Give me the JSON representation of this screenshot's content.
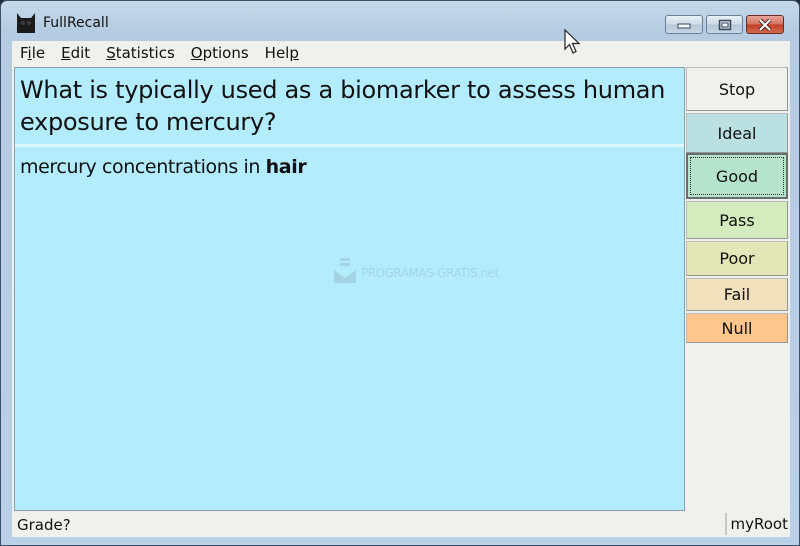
{
  "window": {
    "title": "FullRecall",
    "app_icon": "owl-icon",
    "controls": {
      "minimize": "minimize-icon",
      "maximize": "maximize-icon",
      "close": "close-icon"
    }
  },
  "menubar": {
    "items": [
      {
        "label": "File",
        "mnemonic": "i"
      },
      {
        "label": "Edit",
        "mnemonic": "E"
      },
      {
        "label": "Statistics",
        "mnemonic": "S"
      },
      {
        "label": "Options",
        "mnemonic": "O"
      },
      {
        "label": "Help",
        "mnemonic": "p"
      }
    ]
  },
  "card": {
    "question": "What is typically used as a biomarker to assess human exposure to mercury?",
    "answer_prefix": "mercury concentrations in ",
    "answer_bold": "hair"
  },
  "watermark": {
    "text": "PROGRAMAS-GRATIS.net"
  },
  "grades": [
    {
      "label": "Stop",
      "color": "#f0f0ed",
      "focused": false
    },
    {
      "label": "Ideal",
      "color": "#bae0e2",
      "focused": false
    },
    {
      "label": "Good",
      "color": "#b5e3cb",
      "focused": true
    },
    {
      "label": "Pass",
      "color": "#d3ebbd",
      "focused": false
    },
    {
      "label": "Poor",
      "color": "#e3e6b6",
      "focused": false
    },
    {
      "label": "Fail",
      "color": "#f2dfbb",
      "focused": false
    },
    {
      "label": "Null",
      "color": "#fdc68d",
      "focused": false
    }
  ],
  "statusbar": {
    "left": "Grade?",
    "right": "myRoot"
  },
  "colors": {
    "card_background": "#b3edfd",
    "window_frame": "#b9d0e6",
    "client_background": "#f0f0ed"
  }
}
